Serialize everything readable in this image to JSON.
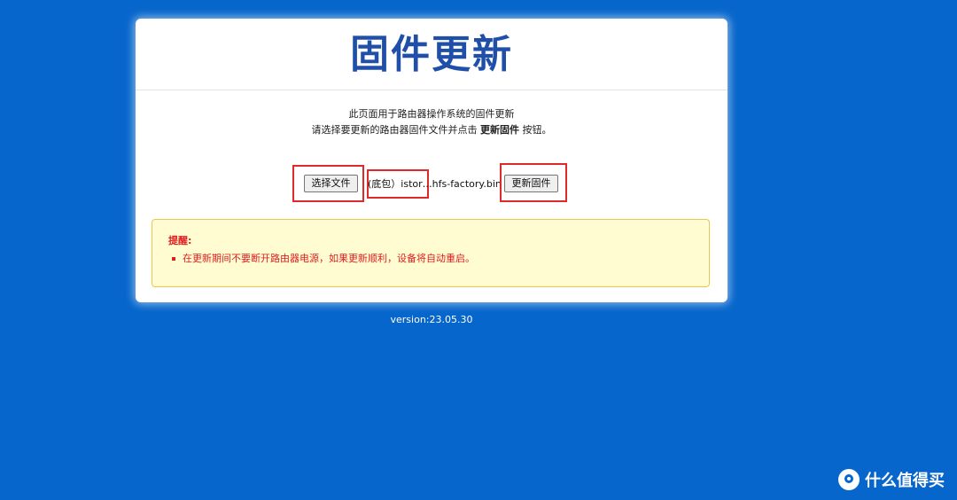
{
  "page": {
    "title": "固件更新",
    "desc_line1": "此页面用于路由器操作系统的固件更新",
    "desc_line2_pre": "请选择要更新的路由器固件文件并点击 ",
    "desc_line2_bold": "更新固件",
    "desc_line2_post": " 按钮。"
  },
  "controls": {
    "choose_file_label": "选择文件",
    "filename": "(底包）istor…hfs-factory.bin",
    "update_label": "更新固件"
  },
  "notice": {
    "title": "提醒:",
    "items": [
      "在更新期间不要断开路由器电源，如果更新顺利，设备将自动重启。"
    ]
  },
  "footer": {
    "version": "version:23.05.30"
  },
  "watermark": {
    "text": "什么值得买",
    "icon": "smzdm-logo-icon"
  },
  "colors": {
    "background": "#0666cc",
    "title": "#1f4fa8",
    "highlight": "#e02a2a",
    "notice_bg": "#fffcd2",
    "notice_text": "#dd1f1f"
  }
}
